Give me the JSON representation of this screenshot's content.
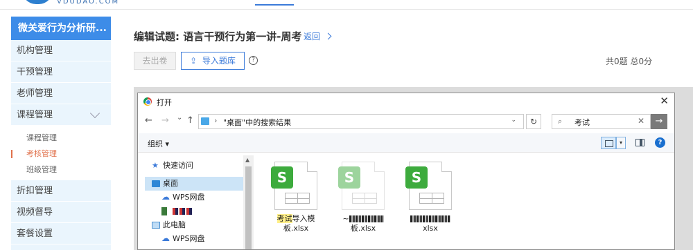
{
  "header": {
    "logo_text": "VDUDAO.COM"
  },
  "sidebar": {
    "brand": "微关爱行为分析研...",
    "items": [
      {
        "label": "机构管理"
      },
      {
        "label": "干预管理"
      },
      {
        "label": "老师管理"
      },
      {
        "label": "课程管理"
      }
    ],
    "sub_items": [
      {
        "label": "课程管理"
      },
      {
        "label": "考核管理"
      },
      {
        "label": "班级管理"
      }
    ],
    "items_after": [
      {
        "label": "折扣管理"
      },
      {
        "label": "视频督导"
      },
      {
        "label": "套餐设置"
      }
    ]
  },
  "main": {
    "title": "编辑试题: 语言干预行为第一讲-周考",
    "back": "返回",
    "export_btn": "去出卷",
    "import_btn": "导入题库",
    "help": "?",
    "totals": "共0题 总0分"
  },
  "dialog": {
    "title": "打开",
    "close": "✕",
    "nav": {
      "back": "←",
      "forward": "→",
      "recent": "⌄",
      "up": "↑"
    },
    "address_sep": "›",
    "address": "\"桌面\"中的搜索结果",
    "address_dd": "⌄",
    "refresh": "↻",
    "search_icon": "⌕",
    "search": "考试",
    "search_clear": "✕",
    "go": "→",
    "toolbar": {
      "organize": "组织 ▾",
      "view_dd": "▾",
      "help": "?"
    },
    "nav_pane": [
      {
        "label": "快速访问",
        "icon": "star-icon",
        "color": "#3b7ad9"
      },
      {
        "label": "桌面",
        "icon": "desktop-icon",
        "color": "#2e87d6"
      },
      {
        "label": "WPS网盘",
        "icon": "cloud-icon",
        "color": "#3b7ad9"
      },
      {
        "label": "",
        "icon": "user-folder-icon",
        "color": "#3a7a3a"
      },
      {
        "label": "此电脑",
        "icon": "computer-icon",
        "color": "#4a90d0"
      },
      {
        "label": "WPS网盘",
        "icon": "cloud-icon",
        "color": "#3b7ad9"
      }
    ],
    "files": [
      {
        "name_hl": "考试",
        "name_rest": "导入模",
        "name_line2": "板.xlsx"
      },
      {
        "name_prefix": "~",
        "name_line2": "板.xlsx"
      },
      {
        "name_line2": "xlsx"
      }
    ]
  }
}
